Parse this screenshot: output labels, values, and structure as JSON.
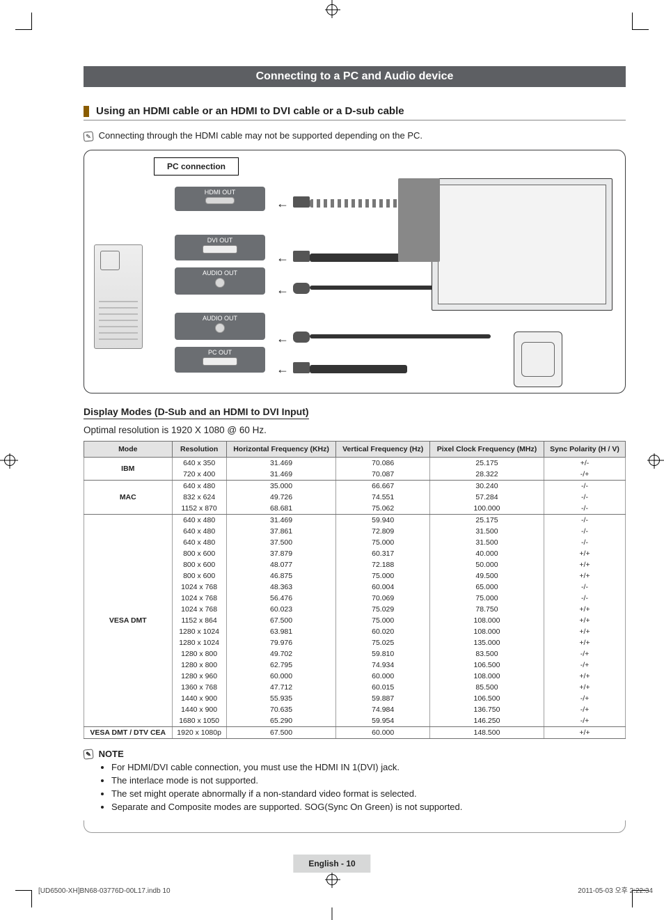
{
  "title": "Connecting to a PC and Audio device",
  "section_heading": "Using an HDMI cable or an HDMI to DVI cable or a D-sub cable",
  "caution_line": "Connecting through the HDMI cable may not be supported depending on the PC.",
  "diagram": {
    "box_label": "PC connection",
    "ports": [
      "HDMI OUT",
      "DVI OUT",
      "AUDIO OUT",
      "AUDIO OUT",
      "PC OUT"
    ]
  },
  "display_modes_heading": "Display Modes (D-Sub and an HDMI to DVI Input)",
  "optimal_text": "Optimal resolution is 1920 X 1080 @ 60 Hz.",
  "table": {
    "headers": [
      "Mode",
      "Resolution",
      "Horizontal Frequency (KHz)",
      "Vertical Frequency (Hz)",
      "Pixel Clock Frequency (MHz)",
      "Sync Polarity (H / V)"
    ],
    "groups": [
      {
        "mode": "IBM",
        "rows": [
          [
            "640 x 350",
            "31.469",
            "70.086",
            "25.175",
            "+/-"
          ],
          [
            "720 x 400",
            "31.469",
            "70.087",
            "28.322",
            "-/+"
          ]
        ]
      },
      {
        "mode": "MAC",
        "rows": [
          [
            "640 x 480",
            "35.000",
            "66.667",
            "30.240",
            "-/-"
          ],
          [
            "832 x 624",
            "49.726",
            "74.551",
            "57.284",
            "-/-"
          ],
          [
            "1152 x 870",
            "68.681",
            "75.062",
            "100.000",
            "-/-"
          ]
        ]
      },
      {
        "mode": "VESA DMT",
        "rows": [
          [
            "640 x 480",
            "31.469",
            "59.940",
            "25.175",
            "-/-"
          ],
          [
            "640 x 480",
            "37.861",
            "72.809",
            "31.500",
            "-/-"
          ],
          [
            "640 x 480",
            "37.500",
            "75.000",
            "31.500",
            "-/-"
          ],
          [
            "800 x 600",
            "37.879",
            "60.317",
            "40.000",
            "+/+"
          ],
          [
            "800 x 600",
            "48.077",
            "72.188",
            "50.000",
            "+/+"
          ],
          [
            "800 x 600",
            "46.875",
            "75.000",
            "49.500",
            "+/+"
          ],
          [
            "1024 x 768",
            "48.363",
            "60.004",
            "65.000",
            "-/-"
          ],
          [
            "1024 x 768",
            "56.476",
            "70.069",
            "75.000",
            "-/-"
          ],
          [
            "1024 x 768",
            "60.023",
            "75.029",
            "78.750",
            "+/+"
          ],
          [
            "1152 x 864",
            "67.500",
            "75.000",
            "108.000",
            "+/+"
          ],
          [
            "1280 x 1024",
            "63.981",
            "60.020",
            "108.000",
            "+/+"
          ],
          [
            "1280 x 1024",
            "79.976",
            "75.025",
            "135.000",
            "+/+"
          ],
          [
            "1280 x 800",
            "49.702",
            "59.810",
            "83.500",
            "-/+"
          ],
          [
            "1280 x 800",
            "62.795",
            "74.934",
            "106.500",
            "-/+"
          ],
          [
            "1280 x 960",
            "60.000",
            "60.000",
            "108.000",
            "+/+"
          ],
          [
            "1360 x 768",
            "47.712",
            "60.015",
            "85.500",
            "+/+"
          ],
          [
            "1440 x 900",
            "55.935",
            "59.887",
            "106.500",
            "-/+"
          ],
          [
            "1440 x 900",
            "70.635",
            "74.984",
            "136.750",
            "-/+"
          ],
          [
            "1680 x 1050",
            "65.290",
            "59.954",
            "146.250",
            "-/+"
          ]
        ]
      },
      {
        "mode": "VESA DMT / DTV CEA",
        "rows": [
          [
            "1920 x 1080p",
            "67.500",
            "60.000",
            "148.500",
            "+/+"
          ]
        ]
      }
    ]
  },
  "note_heading": "NOTE",
  "notes": [
    "For HDMI/DVI cable connection, you must use the HDMI IN 1(DVI) jack.",
    "The interlace mode is not supported.",
    "The set might operate abnormally if a non-standard video format is selected.",
    "Separate and Composite modes are supported. SOG(Sync On Green) is not supported."
  ],
  "page_lang": "English - 10",
  "footer_left": "[UD6500-XH]BN68-03776D-00L17.indb   10",
  "footer_right": "2011-05-03   오후 2:22:34"
}
